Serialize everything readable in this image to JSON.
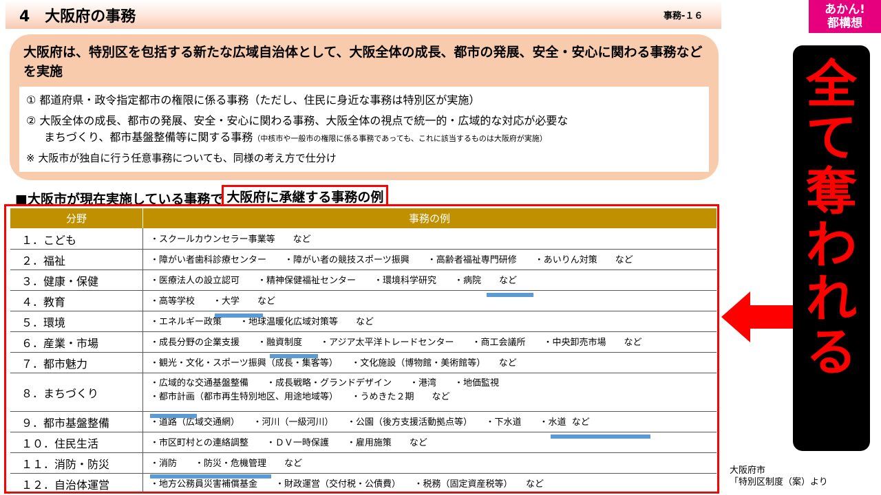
{
  "header": {
    "section_title": "4　大阪府の事務",
    "slide_no": "事務-１６",
    "badge_line1": "あかん!",
    "badge_line2": "都構想"
  },
  "intro": {
    "headline": "大阪府は、特別区を包括する新たな広域自治体として、大阪全体の成長、都市の発展、安全・安心に関わる事務などを実施",
    "item1": "①  都道府県・政令指定都市の権限に係る事務（ただし、住民に身近な事務は特別区が実施）",
    "item2_line1": "②  大阪全体の成長、都市の発展、安全・安心に関わる事務、大阪全体の視点で統一的・広域的な対応が必要な",
    "item2_line2": "まちづくり、都市基盤整備等に関する事務",
    "item2_note": "（中核市や一般市の権限に係る事務であっても、これに該当するものは大阪府が実施）",
    "note": "※  大阪市が独自に行う任意事務についても、同様の考え方で仕分け"
  },
  "table_heading": {
    "prefix": "■大阪市が現在実施している事務で",
    "highlight": "大阪府に承継する事務の例"
  },
  "table": {
    "col1": "分野",
    "col2": "事務の例",
    "rows": [
      {
        "cat": "１．こども",
        "ex": "・スクールカウンセラー事業等　　など"
      },
      {
        "cat": "２．福祉",
        "ex": "・障がい者歯科診療センター　　・障がい者の競技スポーツ振興　　・高齢者福祉専門研修　　・あいりん対策　　など"
      },
      {
        "cat": "３．健康・保健",
        "ex": "・医療法人の設立認可　　・精神保健福祉センター　　・環境科学研究　　・病院　　など"
      },
      {
        "cat": "４．教育",
        "ex": "・高等学校　　・大学　　など"
      },
      {
        "cat": "５．環境",
        "ex": "・エネルギー政策　　・地球温暖化広域対策等　　など"
      },
      {
        "cat": "６．産業・市場",
        "ex": "・成長分野の企業支援　　・融資制度　　・アジア太平洋トレードセンター　　・商工会議所　　・中央卸売市場　　など"
      },
      {
        "cat": "７．都市魅力",
        "ex": "・観光・文化・スポーツ振興（成長・集客等）　　・文化施設（博物館・美術館等）　　など"
      },
      {
        "cat": "８．まちづくり",
        "ex": "・広域的な交通基盤整備　　・成長戦略・グランドデザイン　　・港湾　　・地価監視\n・都市計画（都市再生特別地区、用途地域等）　　・うめきた２期　　など"
      },
      {
        "cat": "９．都市基盤整備",
        "ex": "・道路（広域交通網）　　・河川（一級河川）　　・公園（後方支援活動拠点等）　　・下水道　　・水道  など"
      },
      {
        "cat": "１０．住民生活",
        "ex": "・市区町村との連絡調整　　・ＤＶ一時保護　　・雇用施策　　など"
      },
      {
        "cat": "１１．消防・防災",
        "ex": "・消防　　・防災・危機管理　　など"
      },
      {
        "cat": "１２．自治体運営",
        "ex": "・地方公務員災害補償基金　　・財政運営（交付税・公債費）　　・税務（固定資産税等）　　など"
      }
    ]
  },
  "callout": {
    "chars": [
      "全",
      "て",
      "奪",
      "わ",
      "れ",
      "る"
    ]
  },
  "source": {
    "line1": "大阪府市",
    "line2": "「特別区制度（案）より"
  }
}
